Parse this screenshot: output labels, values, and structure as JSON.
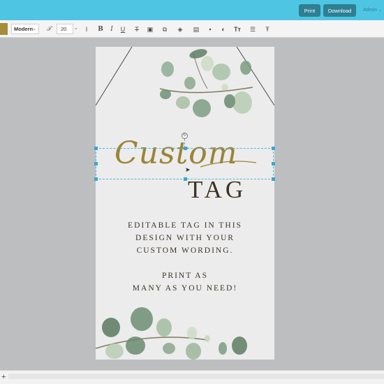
{
  "header": {
    "print_label": "Print",
    "download_label": "Download",
    "admin_label": "Admin",
    "admin_chevron": "⌄",
    "accent_color": "#4ec6e3"
  },
  "toolbar": {
    "font_name": "Modern",
    "font_size": "20",
    "color_swatch": "#a58d3b",
    "icons": [
      "font-style-icon",
      "line-height-icon",
      "bold-icon",
      "italic-icon",
      "underline-icon",
      "strikethrough-icon",
      "image-icon",
      "duplicate-icon",
      "layers-icon",
      "align-icon",
      "lock-icon",
      "color-fill-icon",
      "text-size-icon",
      "list-icon",
      "text-transform-icon"
    ]
  },
  "document": {
    "script_word": "Custom",
    "tag_word": "TAG",
    "body_lines": [
      "EDITABLE TAG IN THIS",
      "DESIGN WITH YOUR",
      "CUSTOM WORDING.",
      "PRINT AS",
      "MANY AS YOU NEED!"
    ],
    "text_color": "#3a3326",
    "script_color": "#9a8436"
  },
  "bottombar": {
    "add_label": "+"
  }
}
